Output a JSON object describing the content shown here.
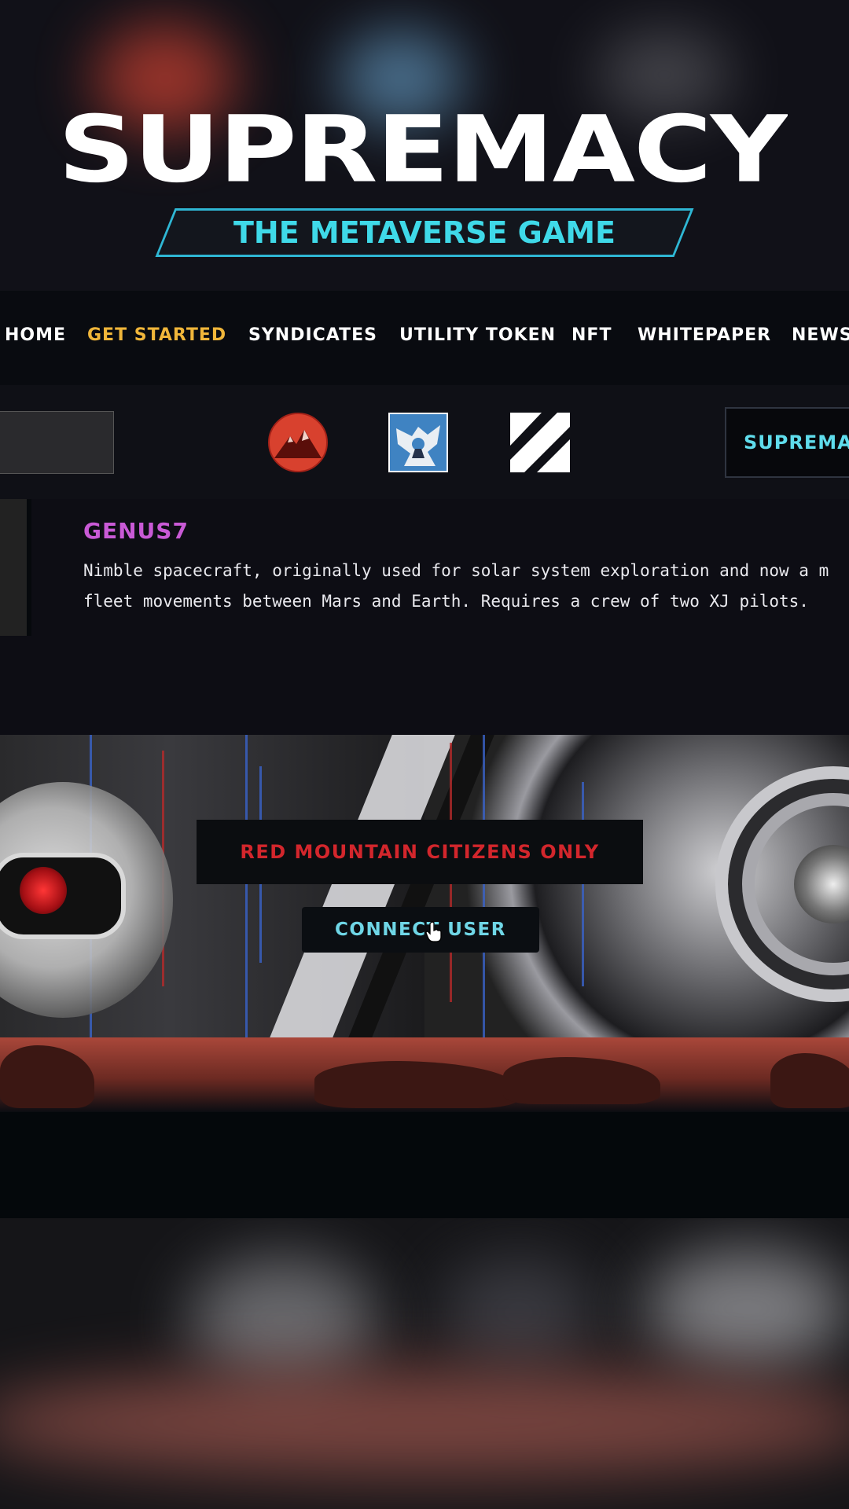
{
  "hero": {
    "logo_text": "SUPREMACY",
    "tagline": "THE METAVERSE GAME"
  },
  "nav": {
    "items": [
      {
        "label": "HOME"
      },
      {
        "label": "GET STARTED",
        "active": true
      },
      {
        "label": "SYNDICATES"
      },
      {
        "label": "UTILITY TOKEN"
      },
      {
        "label": "NFT"
      },
      {
        "label": "WHITEPAPER"
      },
      {
        "label": "NEWS"
      }
    ]
  },
  "factions": {
    "items": [
      {
        "icon": "red-mountain-icon"
      },
      {
        "icon": "boston-cybernetics-icon"
      },
      {
        "icon": "zaibatsu-icon"
      }
    ],
    "supremacy_button": "SUPREMA"
  },
  "ship": {
    "name": "GENUS7",
    "description_line1": "Nimble spacecraft, originally used for solar system exploration and now a m",
    "description_line2": "fleet movements between Mars and Earth. Requires a crew of two XJ pilots."
  },
  "vault": {
    "notice": "RED MOUNTAIN CITIZENS ONLY",
    "connect_label": "CONNECT USER"
  },
  "colors": {
    "accent_cyan": "#3fd9e8",
    "active_nav": "#f0b63a",
    "ship_title": "#c95ad6",
    "notice_red": "#d3262c"
  }
}
